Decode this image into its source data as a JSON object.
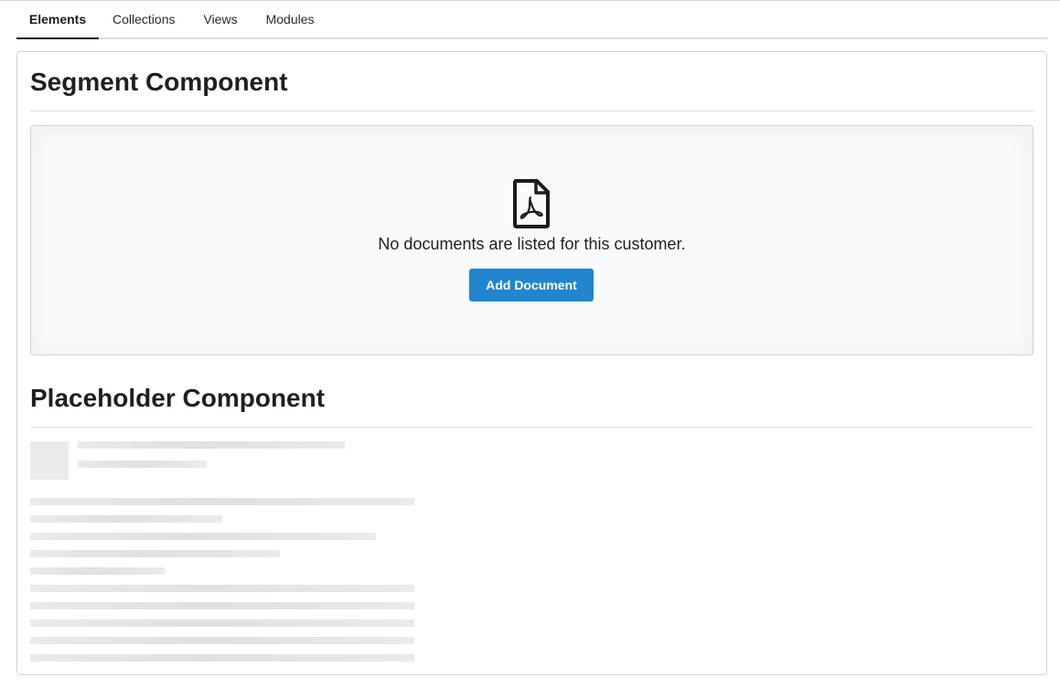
{
  "tabs": [
    {
      "label": "Elements",
      "active": true
    },
    {
      "label": "Collections",
      "active": false
    },
    {
      "label": "Views",
      "active": false
    },
    {
      "label": "Modules",
      "active": false
    }
  ],
  "segment_section": {
    "title": "Segment Component",
    "icon": "file-pdf-icon",
    "empty_message": "No documents are listed for this customer.",
    "button_label": "Add Document",
    "button_color": "#2185d0"
  },
  "placeholder_section": {
    "title": "Placeholder Component"
  },
  "colors": {
    "accent": "#2185d0",
    "placeholder": "#ebebeb"
  }
}
